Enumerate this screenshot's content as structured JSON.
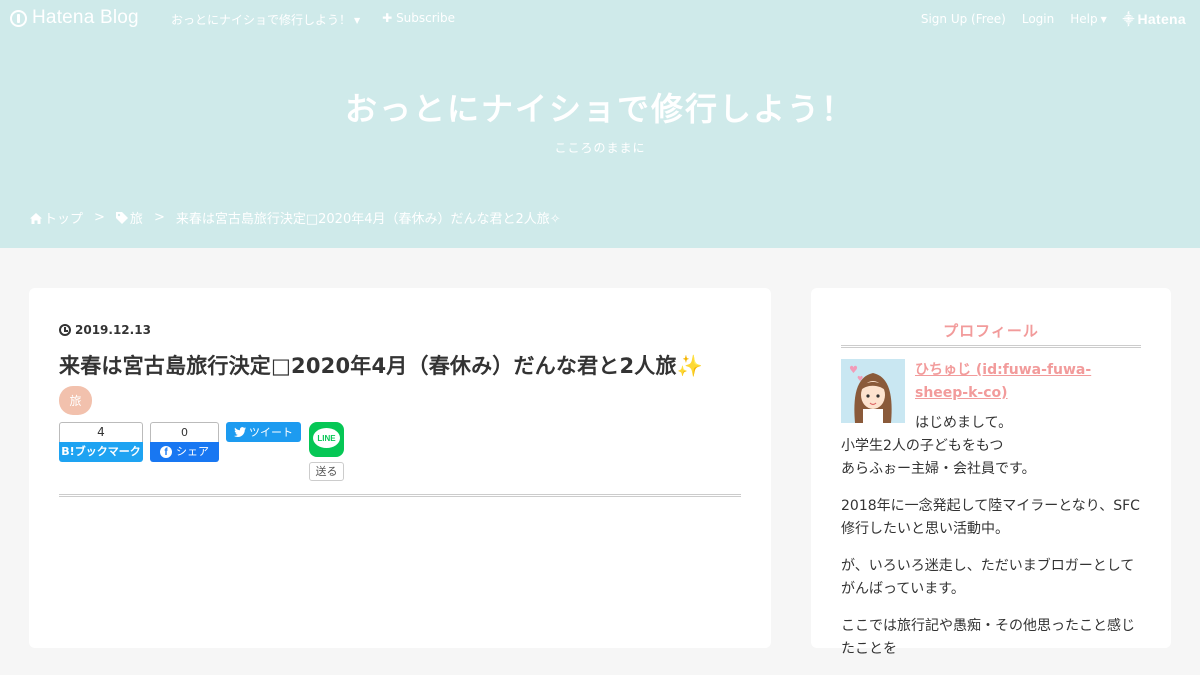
{
  "topbar": {
    "brand": "Hatena Blog",
    "blog_menu": "おっとにナイショで修行しよう！",
    "subscribe": "Subscribe",
    "signup": "Sign Up (Free)",
    "login": "Login",
    "help": "Help",
    "hatena": "Hatena"
  },
  "header": {
    "title": "おっとにナイショで修行しよう！",
    "description": "こころのままに",
    "bg_color": "#cfeaea"
  },
  "breadcrumb": {
    "home": "トップ",
    "separator": ">",
    "category": "旅",
    "current": "来春は宮古島旅行決定□2020年4月（春休み）だんな君と2人旅✧"
  },
  "entry": {
    "date": "2019.12.13",
    "title": "来春は宮古島旅行決定□2020年4月（春休み）だんな君と2人旅✨",
    "category": "旅",
    "share": {
      "hatebu_count": "4",
      "hatebu_label": "B!ブックマーク",
      "fb_count": "0",
      "fb_label": "シェア",
      "tweet_label": "ツイート",
      "line_label": "LINE",
      "line_send": "送る"
    }
  },
  "sidebar": {
    "title": "プロフィール",
    "name": "ひちゅじ (id:fuwa-fuwa-sheep-k-co)",
    "p1a": "はじめまして。",
    "p1b": "小学生2人の子どもをもつ",
    "p1c": "あらふぉー主婦・会社員です。",
    "p2": "2018年に一念発起して陸マイラーとなり、SFC修行したいと思い活動中。",
    "p3": "が、いろいろ迷走し、ただいまブロガーとしてがんばっています。",
    "p4": "ここでは旅行記や愚痴・その他思ったこと感じたことを"
  },
  "colors": {
    "accent": "#f29b9b",
    "category_chip": "#f2c1ad",
    "hatebu": "#1ea3f2",
    "facebook": "#1877f2",
    "twitter": "#1d9bf0",
    "line": "#06c755"
  }
}
